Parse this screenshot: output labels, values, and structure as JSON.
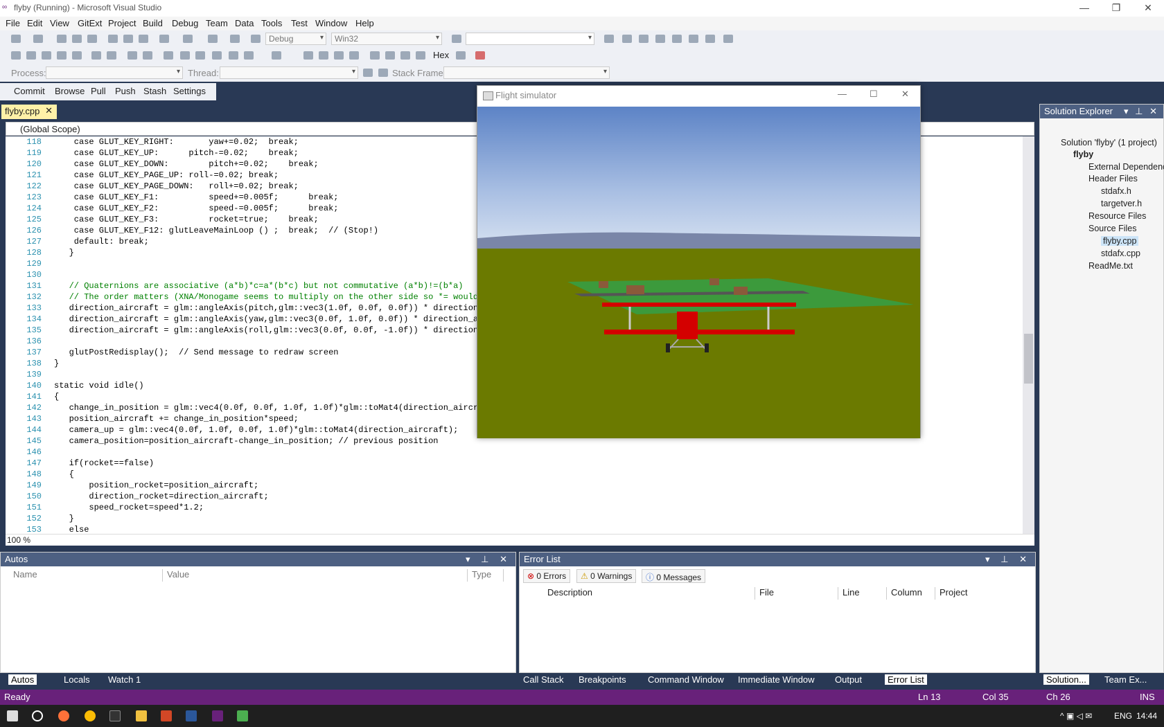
{
  "window": {
    "title": "flyby (Running) - Microsoft Visual Studio"
  },
  "menu": [
    "File",
    "Edit",
    "View",
    "GitExt",
    "Project",
    "Build",
    "Debug",
    "Team",
    "Data",
    "Tools",
    "Test",
    "Window",
    "Help"
  ],
  "toolbar": {
    "config": "Debug",
    "platform": "Win32",
    "hex": "Hex",
    "process_label": "Process:",
    "thread_label": "Thread:",
    "stackframe_label": "Stack Frame:"
  },
  "git": [
    "Commit",
    "Browse",
    "Pull",
    "Push",
    "Stash",
    "Settings"
  ],
  "editor": {
    "tab": "flyby.cpp",
    "scope": "(Global Scope)",
    "zoom": "100 %",
    "lines": [
      {
        "n": "118",
        "t": "    case GLUT_KEY_RIGHT:       yaw+=0.02;  break;"
      },
      {
        "n": "119",
        "t": "    case GLUT_KEY_UP:      pitch-=0.02;    break;"
      },
      {
        "n": "120",
        "t": "    case GLUT_KEY_DOWN:        pitch+=0.02;    break;"
      },
      {
        "n": "121",
        "t": "    case GLUT_KEY_PAGE_UP: roll-=0.02; break;"
      },
      {
        "n": "122",
        "t": "    case GLUT_KEY_PAGE_DOWN:   roll+=0.02; break;"
      },
      {
        "n": "123",
        "t": "    case GLUT_KEY_F1:          speed+=0.005f;      break;"
      },
      {
        "n": "124",
        "t": "    case GLUT_KEY_F2:          speed-=0.005f;      break;"
      },
      {
        "n": "125",
        "t": "    case GLUT_KEY_F3:          rocket=true;    break;"
      },
      {
        "n": "126",
        "t": "    case GLUT_KEY_F12: glutLeaveMainLoop () ;  break;  // (Stop!)"
      },
      {
        "n": "127",
        "t": "    default: break;"
      },
      {
        "n": "128",
        "t": "   }"
      },
      {
        "n": "129",
        "t": ""
      },
      {
        "n": "130",
        "t": ""
      },
      {
        "n": "131",
        "t": "   // Quaternions are associative (a*b)*c=a*(b*c) but not commutative (a*b)!=(b*a)"
      },
      {
        "n": "132",
        "t": "   // The order matters (XNA/Monogame seems to multiply on the other side so *= would"
      },
      {
        "n": "133",
        "t": "   direction_aircraft = glm::angleAxis(pitch,glm::vec3(1.0f, 0.0f, 0.0f)) * direction_"
      },
      {
        "n": "134",
        "t": "   direction_aircraft = glm::angleAxis(yaw,glm::vec3(0.0f, 1.0f, 0.0f)) * direction_ai"
      },
      {
        "n": "135",
        "t": "   direction_aircraft = glm::angleAxis(roll,glm::vec3(0.0f, 0.0f, -1.0f)) * direction_"
      },
      {
        "n": "136",
        "t": ""
      },
      {
        "n": "137",
        "t": "   glutPostRedisplay();  // Send message to redraw screen"
      },
      {
        "n": "138",
        "t": "}"
      },
      {
        "n": "139",
        "t": ""
      },
      {
        "n": "140",
        "t": "static void idle()"
      },
      {
        "n": "141",
        "t": "{"
      },
      {
        "n": "142",
        "t": "   change_in_position = glm::vec4(0.0f, 0.0f, 1.0f, 1.0f)*glm::toMat4(direction_aircra"
      },
      {
        "n": "143",
        "t": "   position_aircraft += change_in_position*speed;"
      },
      {
        "n": "144",
        "t": "   camera_up = glm::vec4(0.0f, 1.0f, 0.0f, 1.0f)*glm::toMat4(direction_aircraft);"
      },
      {
        "n": "145",
        "t": "   camera_position=position_aircraft-change_in_position; // previous position"
      },
      {
        "n": "146",
        "t": ""
      },
      {
        "n": "147",
        "t": "   if(rocket==false)"
      },
      {
        "n": "148",
        "t": "   {"
      },
      {
        "n": "149",
        "t": "       position_rocket=position_aircraft;"
      },
      {
        "n": "150",
        "t": "       direction_rocket=direction_aircraft;"
      },
      {
        "n": "151",
        "t": "       speed_rocket=speed*1.2;"
      },
      {
        "n": "152",
        "t": "   }"
      },
      {
        "n": "153",
        "t": "   else"
      }
    ]
  },
  "flight": {
    "title": "Flight simulator"
  },
  "autos": {
    "title": "Autos",
    "cols": [
      "Name",
      "Value",
      "Type"
    ],
    "tabs": [
      "Autos",
      "Locals",
      "Watch 1"
    ]
  },
  "errors": {
    "title": "Error List",
    "errors": "0 Errors",
    "warnings": "0 Warnings",
    "messages": "0 Messages",
    "cols": [
      "Description",
      "File",
      "Line",
      "Column",
      "Project"
    ],
    "tabs": [
      "Call Stack",
      "Breakpoints",
      "Command Window",
      "Immediate Window",
      "Output",
      "Error List"
    ]
  },
  "solution": {
    "title": "Solution Explorer",
    "root": "Solution 'flyby' (1 project)",
    "project": "flyby",
    "external": "External Dependenc",
    "header": "Header Files",
    "h1": "stdafx.h",
    "h2": "targetver.h",
    "resource": "Resource Files",
    "source": "Source Files",
    "s1": "flyby.cpp",
    "s2": "stdafx.cpp",
    "readme": "ReadMe.txt",
    "tabs": [
      "Solution...",
      "Team Ex..."
    ]
  },
  "status": {
    "ready": "Ready",
    "ln": "Ln 13",
    "col": "Col 35",
    "ch": "Ch 26",
    "ins": "INS"
  },
  "taskbar": {
    "lang": "ENG",
    "time": "14:44"
  }
}
